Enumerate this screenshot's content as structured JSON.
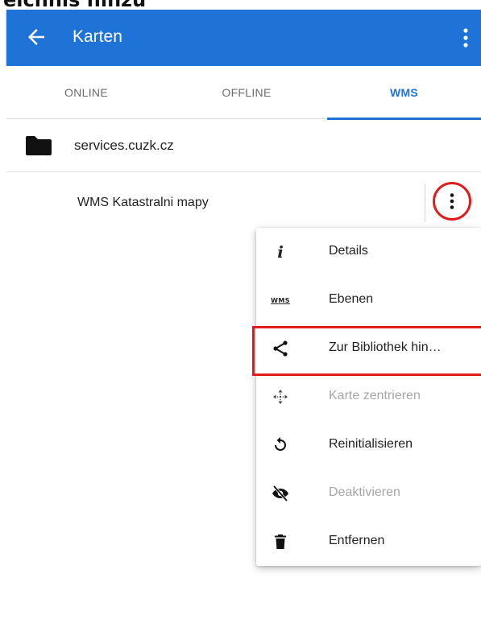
{
  "caption": {
    "text": "eichnis hinzu"
  },
  "colors": {
    "app_bar": "#1f73d6",
    "accent": "#1f73d6",
    "highlight": "#e11b1b",
    "disabled_text": "#a6a6a6"
  },
  "header": {
    "title": "Karten",
    "back_icon": "arrow-left-icon",
    "menu_icon": "more-vertical-icon"
  },
  "tabs": [
    {
      "label": "ONLINE",
      "selected": false
    },
    {
      "label": "OFFLINE",
      "selected": false
    },
    {
      "label": "WMS",
      "selected": true
    }
  ],
  "folder": {
    "label": "services.cuzk.cz",
    "icon": "folder-icon"
  },
  "map_item": {
    "label": "WMS Katastralni mapy",
    "menu_icon": "more-vertical-icon"
  },
  "context_menu": {
    "items": [
      {
        "label": "Details",
        "icon": "info-icon",
        "enabled": true
      },
      {
        "label": "Ebenen",
        "icon": "wms-layers-icon",
        "enabled": true
      },
      {
        "label": "Zur Bibliothek hin…",
        "icon": "share-icon",
        "enabled": true,
        "highlighted": true
      },
      {
        "label": "Karte zentrieren",
        "icon": "center-map-icon",
        "enabled": false
      },
      {
        "label": "Reinitialisieren",
        "icon": "refresh-icon",
        "enabled": true
      },
      {
        "label": "Deaktivieren",
        "icon": "eye-off-icon",
        "enabled": false
      },
      {
        "label": "Entfernen",
        "icon": "trash-icon",
        "enabled": true
      }
    ],
    "wms_icon_text": "WMS"
  }
}
